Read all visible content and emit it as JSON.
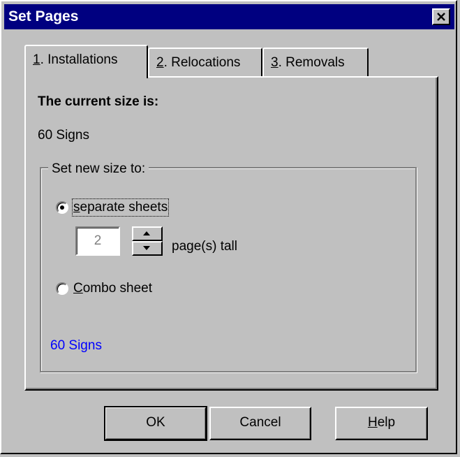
{
  "window": {
    "title": "Set Pages",
    "close_icon": "close-icon"
  },
  "tabs": [
    {
      "mnemonic": "1",
      "rest": ". Installations",
      "active": true
    },
    {
      "mnemonic": "2",
      "rest": ". Relocations",
      "active": false
    },
    {
      "mnemonic": "3",
      "rest": ". Removals",
      "active": false
    }
  ],
  "panel": {
    "current_size_label": "The current size is:",
    "current_size_value": "60 Signs",
    "group_label": "Set new size to:",
    "option_separate": {
      "mnemonic": "s",
      "rest": "eparate sheets",
      "selected": true
    },
    "pages_value": "2",
    "pages_suffix": "page(s) tall",
    "option_combo": {
      "mnemonic": "C",
      "rest": "ombo sheet",
      "selected": false
    },
    "result_text": "60 Signs",
    "result_color": "#0000ff"
  },
  "buttons": {
    "ok": "OK",
    "cancel": "Cancel",
    "help_mnemonic": "H",
    "help_rest": "elp"
  }
}
